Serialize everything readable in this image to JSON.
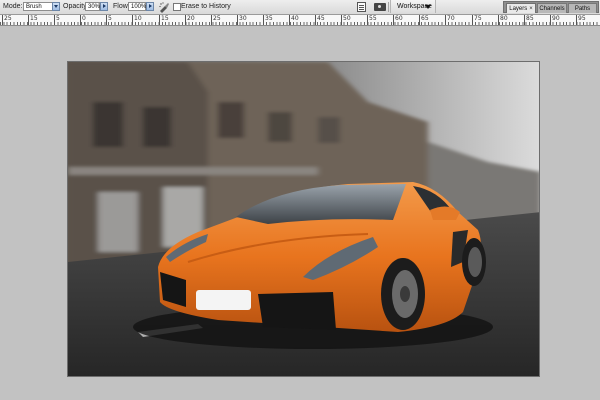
{
  "options_bar": {
    "mode_label": "Mode:",
    "mode_value": "Brush",
    "opacity_label": "Opacity:",
    "opacity_value": "30%",
    "flow_label": "Flow:",
    "flow_value": "100%",
    "erase_to_history_label": "Erase to History",
    "erase_to_history_checked": false,
    "workspace_label": "Workspace"
  },
  "panel_tabs": [
    {
      "label": "Layers",
      "active": true,
      "close": "×"
    },
    {
      "label": "Channels",
      "active": false
    },
    {
      "label": "Paths",
      "active": false
    }
  ],
  "ruler": {
    "labels": [
      "25",
      "15",
      "5",
      "0",
      "5",
      "10",
      "15",
      "20",
      "25",
      "30",
      "35",
      "40",
      "45",
      "50",
      "55",
      "60",
      "65",
      "70",
      "75",
      "80",
      "85",
      "90",
      "95"
    ]
  },
  "document": {
    "colors": {
      "car_orange": "#e8741e",
      "sky": "#d9d9d9",
      "road": "#3a3a3a"
    }
  },
  "icons": [
    "airbrush-icon",
    "document-icon",
    "camera-icon",
    "dropdown-arrow-icon"
  ]
}
